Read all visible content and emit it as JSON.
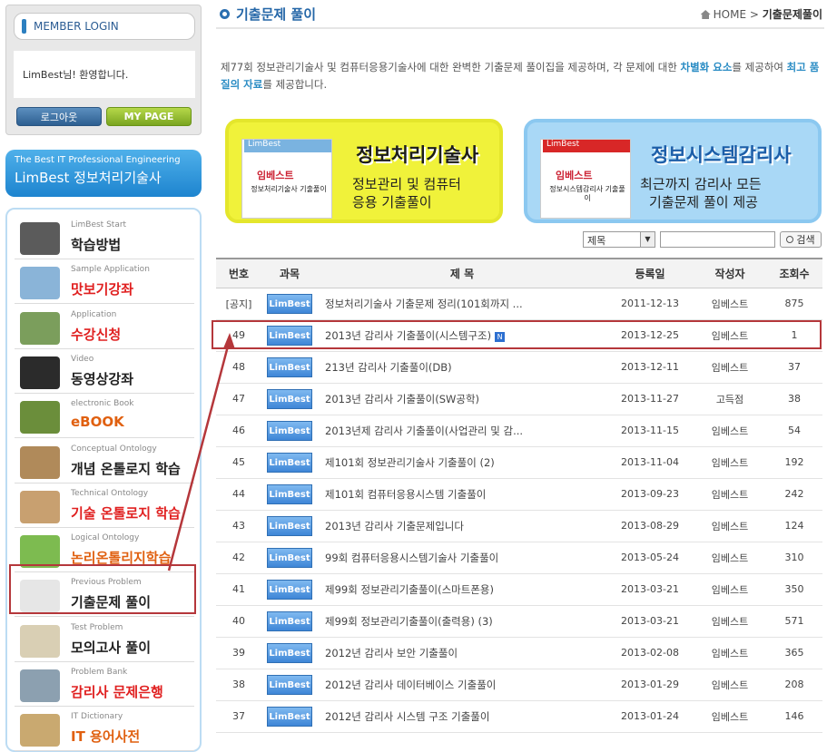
{
  "login": {
    "title": "MEMBER LOGIN",
    "welcome": "LimBest님! 환영합니다.",
    "logout_label": "로그아웃",
    "mypage_label": "MY PAGE"
  },
  "banner": {
    "small": "The Best IT Professional Engineering",
    "big": "LimBest 정보처리기술사"
  },
  "menu": [
    {
      "small": "LimBest Start",
      "label": "학습방법",
      "color": "#222"
    },
    {
      "small": "Sample Application",
      "label": "맛보기강좌",
      "color": "#e02020"
    },
    {
      "small": "Application",
      "label": "수강신청",
      "color": "#e02020"
    },
    {
      "small": "Video",
      "label": "동영상강좌",
      "color": "#222"
    },
    {
      "small": "electronic Book",
      "label": "eBOOK",
      "color": "#e06010"
    },
    {
      "small": "Conceptual Ontology",
      "label": "개념 온톨로지 학습",
      "color": "#222"
    },
    {
      "small": "Technical Ontology",
      "label": "기술 온톨로지 학습",
      "color": "#e02020"
    },
    {
      "small": "Logical Ontology",
      "label": "논리온톨리지학습",
      "color": "#e06010"
    },
    {
      "small": "Previous Problem",
      "label": "기출문제 풀이",
      "color": "#222"
    },
    {
      "small": "Test Problem",
      "label": "모의고사 풀이",
      "color": "#222"
    },
    {
      "small": "Problem Bank",
      "label": "감리사 문제은행",
      "color": "#e02020"
    },
    {
      "small": "IT Dictionary",
      "label": "IT 용어사전",
      "color": "#e06010"
    }
  ],
  "header": {
    "title": "기출문제 풀이",
    "crumb_home": "HOME",
    "crumb_sep": " > ",
    "crumb_current": "기출문제풀이"
  },
  "intro": {
    "p1": "제77회 정보관리기술사 및 컴퓨터응용기술사에 대한 완벽한 기출문제 풀이집을 제공하며, 각 문제에 대한 ",
    "b1": "차별화 요소",
    "p2": "를 제공하여 ",
    "b2": "최고 품질의 자료",
    "p3": "를 제공합니다."
  },
  "promo1": {
    "book_tag": "LimBest",
    "book_title": "임베스트",
    "book_sub": "정보처리기술사 기출풀이",
    "head": "정보처리기술사",
    "sub1": "정보관리 및 컴퓨터",
    "sub2": "응용 기출풀이"
  },
  "promo2": {
    "book_tag": "LimBest",
    "book_title": "임베스트",
    "book_sub": "정보시스템감리사 기출풀이",
    "head": "정보시스템감리사",
    "sub1": "최근까지 감리사 모든",
    "sub2": "기출문제 풀이 제공"
  },
  "search": {
    "select_value": "제목",
    "button_label": "검색"
  },
  "table": {
    "headers": [
      "번호",
      "과목",
      "제 목",
      "등록일",
      "작성자",
      "조회수"
    ],
    "badge": "LimBest",
    "new_icon": "N",
    "rows": [
      {
        "no": "[공지]",
        "title": "정보처리기술사 기출문제 정리(101회까지 ...",
        "date": "2011-12-13",
        "author": "임베스트",
        "views": "875"
      },
      {
        "no": "49",
        "title": "2013년 감리사 기출풀이(시스템구조)",
        "date": "2013-12-25",
        "author": "임베스트",
        "views": "1"
      },
      {
        "no": "48",
        "title": "213년 감리사 기출풀이(DB)",
        "date": "2013-12-11",
        "author": "임베스트",
        "views": "37"
      },
      {
        "no": "47",
        "title": "2013년 감리사 기출풀이(SW공학)",
        "date": "2013-11-27",
        "author": "고득점",
        "views": "38"
      },
      {
        "no": "46",
        "title": "2013년제 감리사 기출풀이(사업관리 및 감...",
        "date": "2013-11-15",
        "author": "임베스트",
        "views": "54"
      },
      {
        "no": "45",
        "title": "제101회 정보관리기술사 기출풀이 (2)",
        "date": "2013-11-04",
        "author": "임베스트",
        "views": "192"
      },
      {
        "no": "44",
        "title": "제101회 컴퓨터응용시스템 기출풀이",
        "date": "2013-09-23",
        "author": "임베스트",
        "views": "242"
      },
      {
        "no": "43",
        "title": "2013년 감리사 기출문제입니다",
        "date": "2013-08-29",
        "author": "임베스트",
        "views": "124"
      },
      {
        "no": "42",
        "title": "99회 컴퓨터응용시스템기술사 기출풀이",
        "date": "2013-05-24",
        "author": "임베스트",
        "views": "310"
      },
      {
        "no": "41",
        "title": "제99회 정보관리기출풀이(스마트폰용)",
        "date": "2013-03-21",
        "author": "임베스트",
        "views": "350"
      },
      {
        "no": "40",
        "title": "제99회 정보관리기출풀이(출력용) (3)",
        "date": "2013-03-21",
        "author": "임베스트",
        "views": "571"
      },
      {
        "no": "39",
        "title": "2012년 감리사 보안 기출풀이",
        "date": "2013-02-08",
        "author": "임베스트",
        "views": "365"
      },
      {
        "no": "38",
        "title": "2012년 감리사 데이터베이스 기출풀이",
        "date": "2013-01-29",
        "author": "임베스트",
        "views": "208"
      },
      {
        "no": "37",
        "title": "2012년 감리사 시스템 구조 기출풀이",
        "date": "2013-01-24",
        "author": "임베스트",
        "views": "146"
      }
    ]
  }
}
